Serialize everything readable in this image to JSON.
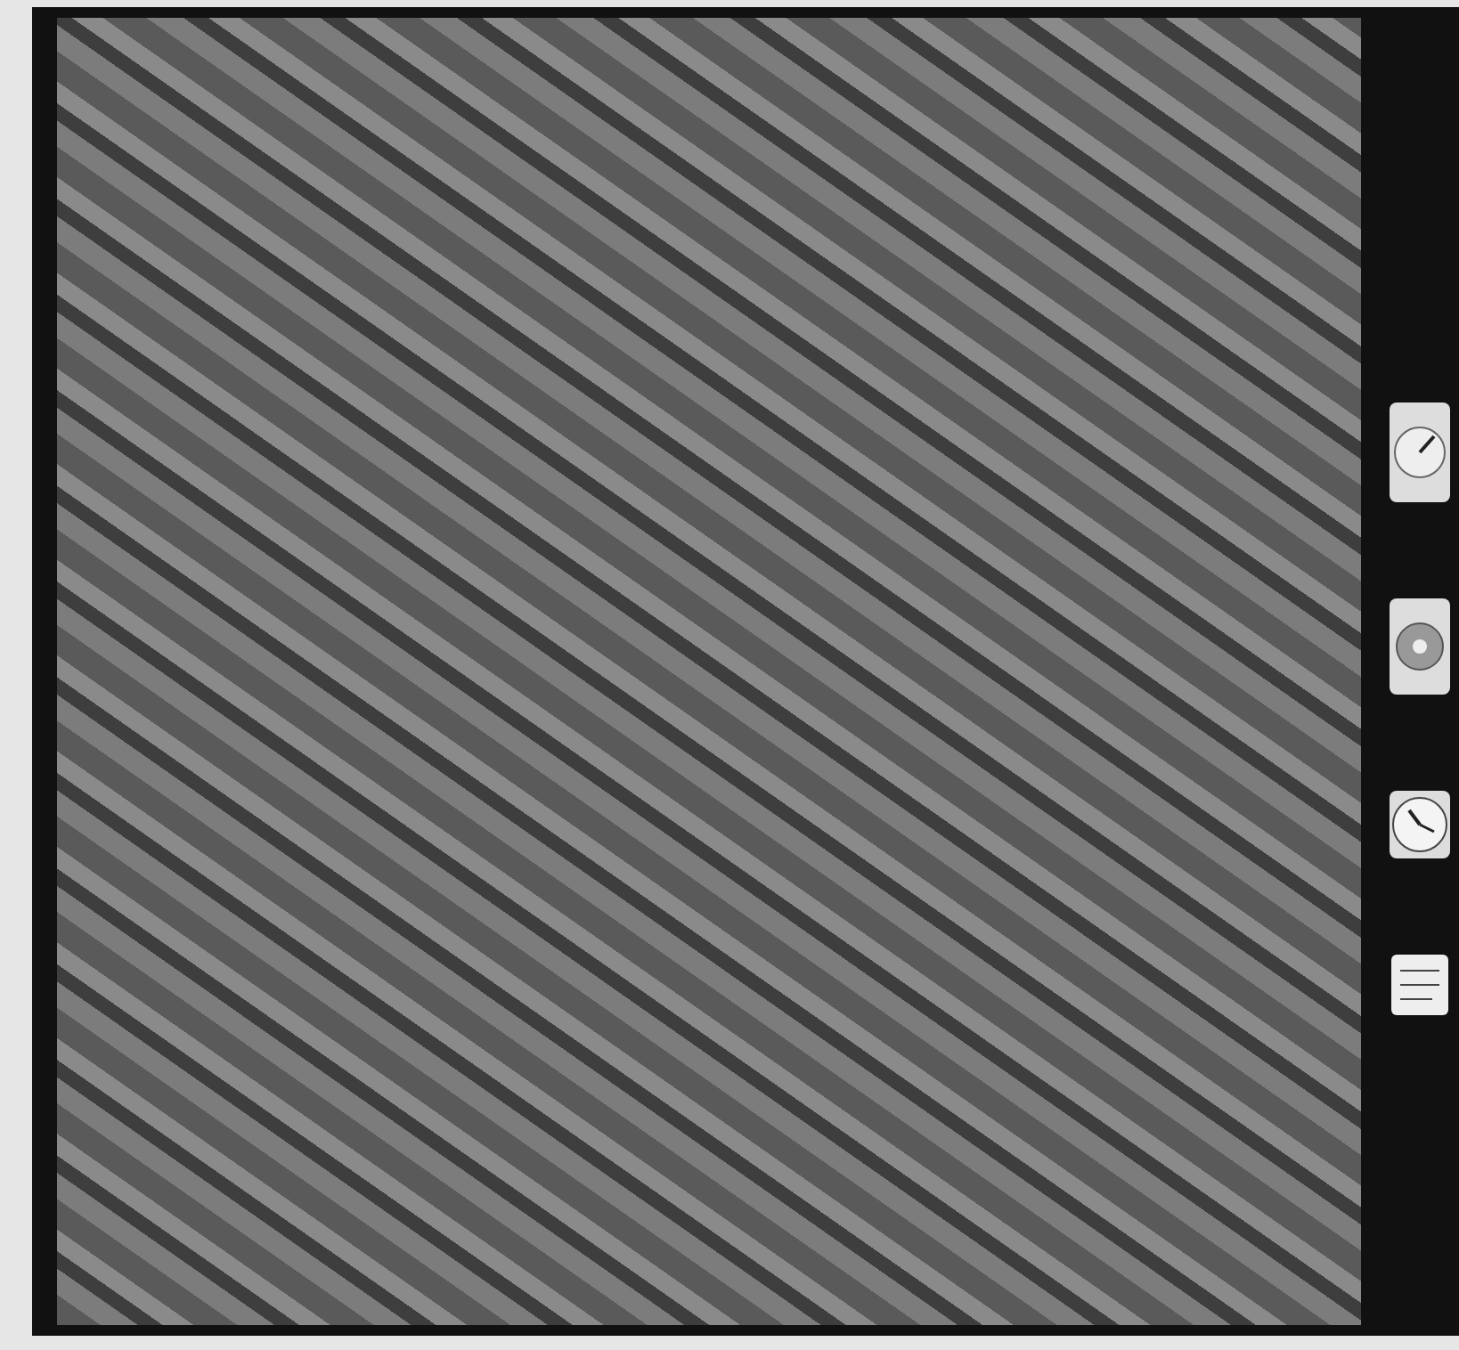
{
  "photo": {
    "kind": "aerial"
  },
  "instruments": [
    {
      "kind": "altimeter"
    },
    {
      "kind": "level"
    },
    {
      "kind": "clock"
    },
    {
      "kind": "label"
    }
  ]
}
